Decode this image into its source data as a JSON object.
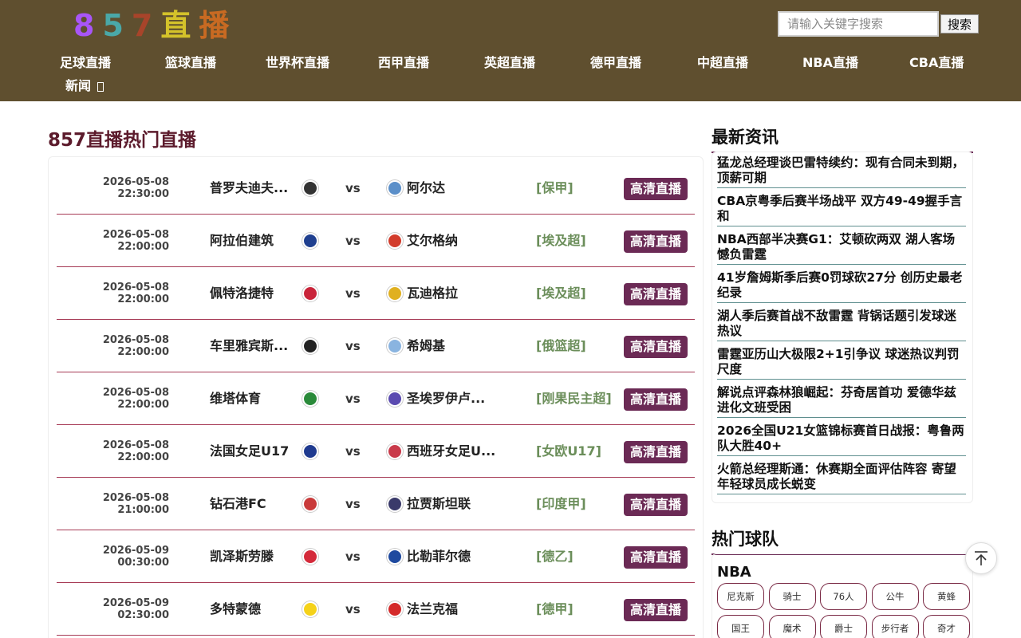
{
  "header": {
    "logo_chars": [
      {
        "text": "8",
        "color": "#a855f7"
      },
      {
        "text": "5",
        "color": "#4aa8a8"
      },
      {
        "text": "7",
        "color": "#a8442a"
      },
      {
        "text": "直",
        "color": "#d4c22a"
      },
      {
        "text": "播",
        "color": "#c86a22"
      }
    ],
    "search_placeholder": "请输入关键字搜索",
    "search_button": "搜索",
    "nav": [
      "足球直播",
      "篮球直播",
      "世界杯直播",
      "西甲直播",
      "英超直播",
      "德甲直播",
      "中超直播",
      "NBA直播",
      "CBA直播",
      "新闻 "
    ]
  },
  "main": {
    "title": "857直播热门直播",
    "matches": [
      {
        "date": "2026-05-08",
        "time": "22:30:00",
        "home": "普罗夫迪夫...",
        "away": "阿尔达",
        "league": "[保甲]",
        "watch": "高清直播",
        "home_color": "#333",
        "away_color": "#5b8fc9"
      },
      {
        "date": "2026-05-08",
        "time": "22:00:00",
        "home": "阿拉伯建筑",
        "away": "艾尔格纳",
        "league": "[埃及超]",
        "watch": "高清直播",
        "home_color": "#1f3f8f",
        "away_color": "#d23b2b"
      },
      {
        "date": "2026-05-08",
        "time": "22:00:00",
        "home": "佩特洛捷特",
        "away": "瓦迪格拉",
        "league": "[埃及超]",
        "watch": "高清直播",
        "home_color": "#c9243a",
        "away_color": "#e0b020"
      },
      {
        "date": "2026-05-08",
        "time": "22:00:00",
        "home": "车里雅宾斯...",
        "away": "希姆基",
        "league": "[俄篮超]",
        "watch": "高清直播",
        "home_color": "#222",
        "away_color": "#8ab4e0"
      },
      {
        "date": "2026-05-08",
        "time": "22:00:00",
        "home": "维塔体育",
        "away": "圣埃罗伊卢...",
        "league": "[刚果民主超]",
        "watch": "高清直播",
        "home_color": "#2a8a3a",
        "away_color": "#5a4ab0"
      },
      {
        "date": "2026-05-08",
        "time": "22:00:00",
        "home": "法国女足U17",
        "away": "西班牙女足U...",
        "league": "[女欧U17]",
        "watch": "高清直播",
        "home_color": "#1f3a8f",
        "away_color": "#c93a4a"
      },
      {
        "date": "2026-05-08",
        "time": "21:00:00",
        "home": "钻石港FC",
        "away": "拉贾斯坦联",
        "league": "[印度甲]",
        "watch": "高清直播",
        "home_color": "#c93a3a",
        "away_color": "#3a3a6a"
      },
      {
        "date": "2026-05-09",
        "time": "00:30:00",
        "home": "凯泽斯劳滕",
        "away": "比勒菲尔德",
        "league": "[德乙]",
        "watch": "高清直播",
        "home_color": "#d42a3a",
        "away_color": "#1f4a9f"
      },
      {
        "date": "2026-05-09",
        "time": "02:30:00",
        "home": "多特蒙德",
        "away": "法兰克福",
        "league": "[德甲]",
        "watch": "高清直播",
        "home_color": "#f5d21a",
        "away_color": "#d42a2a"
      }
    ]
  },
  "sidebar": {
    "news_title": "最新资讯",
    "news": [
      "猛龙总经理谈巴雷特续约：现有合同未到期，顶薪可期",
      "CBA京粤季后赛半场战平 双方49-49握手言和",
      "NBA西部半决赛G1：艾顿砍两双 湖人客场憾负雷霆",
      "41岁詹姆斯季后赛0罚球砍27分 创历史最老纪录",
      "湖人季后赛首战不敌雷霆 背锅话题引发球迷热议",
      "雷霆亚历山大极限2+1引争议 球迷热议判罚尺度",
      "解说点评森林狼崛起：芬奇居首功 爱德华兹进化文班受困",
      "2026全国U21女篮锦标赛首日战报：粤鲁两队大胜40+",
      "火箭总经理斯通：休赛期全面评估阵容 寄望年轻球员成长蜕变"
    ],
    "teams_title": "热门球队",
    "teams_league": "NBA",
    "teams": [
      "尼克斯",
      "骑士",
      "76人",
      "公牛",
      "黄蜂",
      "国王",
      "魔术",
      "爵士",
      "步行者",
      "奇才"
    ]
  }
}
